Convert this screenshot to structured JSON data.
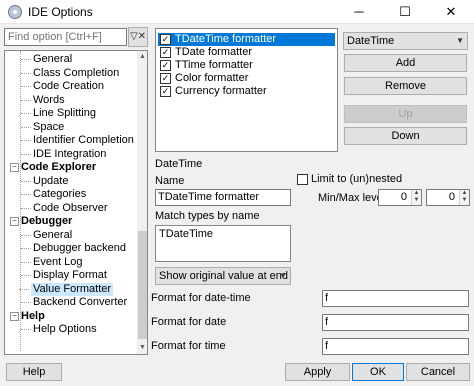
{
  "window": {
    "title": "IDE Options",
    "minimize": "─",
    "maximize": "☐",
    "close": "✕"
  },
  "search": {
    "placeholder": "Find option [Ctrl+F]",
    "clear_icon": "filter-clear-icon"
  },
  "tree": {
    "items": [
      {
        "label": "General",
        "level": 1
      },
      {
        "label": "Class Completion",
        "level": 1
      },
      {
        "label": "Code Creation",
        "level": 1
      },
      {
        "label": "Words",
        "level": 1
      },
      {
        "label": "Line Splitting",
        "level": 1
      },
      {
        "label": "Space",
        "level": 1
      },
      {
        "label": "Identifier Completion",
        "level": 1
      },
      {
        "label": "IDE Integration",
        "level": 1
      },
      {
        "label": "Code Explorer",
        "level": 0,
        "expander": "−"
      },
      {
        "label": "Update",
        "level": 1
      },
      {
        "label": "Categories",
        "level": 1
      },
      {
        "label": "Code Observer",
        "level": 1
      },
      {
        "label": "Debugger",
        "level": 0,
        "expander": "−"
      },
      {
        "label": "General",
        "level": 1
      },
      {
        "label": "Debugger backend",
        "level": 1
      },
      {
        "label": "Event Log",
        "level": 1
      },
      {
        "label": "Display Format",
        "level": 1
      },
      {
        "label": "Value Formatter",
        "level": 1,
        "selected": true
      },
      {
        "label": "Backend Converter",
        "level": 1
      },
      {
        "label": "Help",
        "level": 0,
        "expander": "−"
      },
      {
        "label": "Help Options",
        "level": 1
      }
    ]
  },
  "formatters": [
    {
      "label": "TDateTime formatter",
      "checked": true,
      "selected": true
    },
    {
      "label": "TDate formatter",
      "checked": true
    },
    {
      "label": "TTime formatter",
      "checked": true
    },
    {
      "label": "Color formatter",
      "checked": true
    },
    {
      "label": "Currency formatter",
      "checked": true
    }
  ],
  "check_mark": "✓",
  "type_combo": {
    "value": "DateTime",
    "arrow": "▼"
  },
  "buttons": {
    "add": "Add",
    "remove": "Remove",
    "up": "Up",
    "down": "Down"
  },
  "section_title": "DateTime",
  "name_label": "Name",
  "name_value": "TDateTime formatter",
  "limit_label": "Limit to (un)nested",
  "minmax_label": "Min/Max level",
  "min_level": "0",
  "max_level": "0",
  "match_label": "Match types by name",
  "match_value": "TDateTime",
  "show_combo": {
    "value": "Show original value at end",
    "arrow": "▼"
  },
  "format_fields": [
    {
      "label": "Format for date-time",
      "value": "f"
    },
    {
      "label": "Format for date",
      "value": "f"
    },
    {
      "label": "Format for time",
      "value": "f"
    }
  ],
  "footer": {
    "help": "Help",
    "apply": "Apply",
    "ok": "OK",
    "cancel": "Cancel"
  }
}
